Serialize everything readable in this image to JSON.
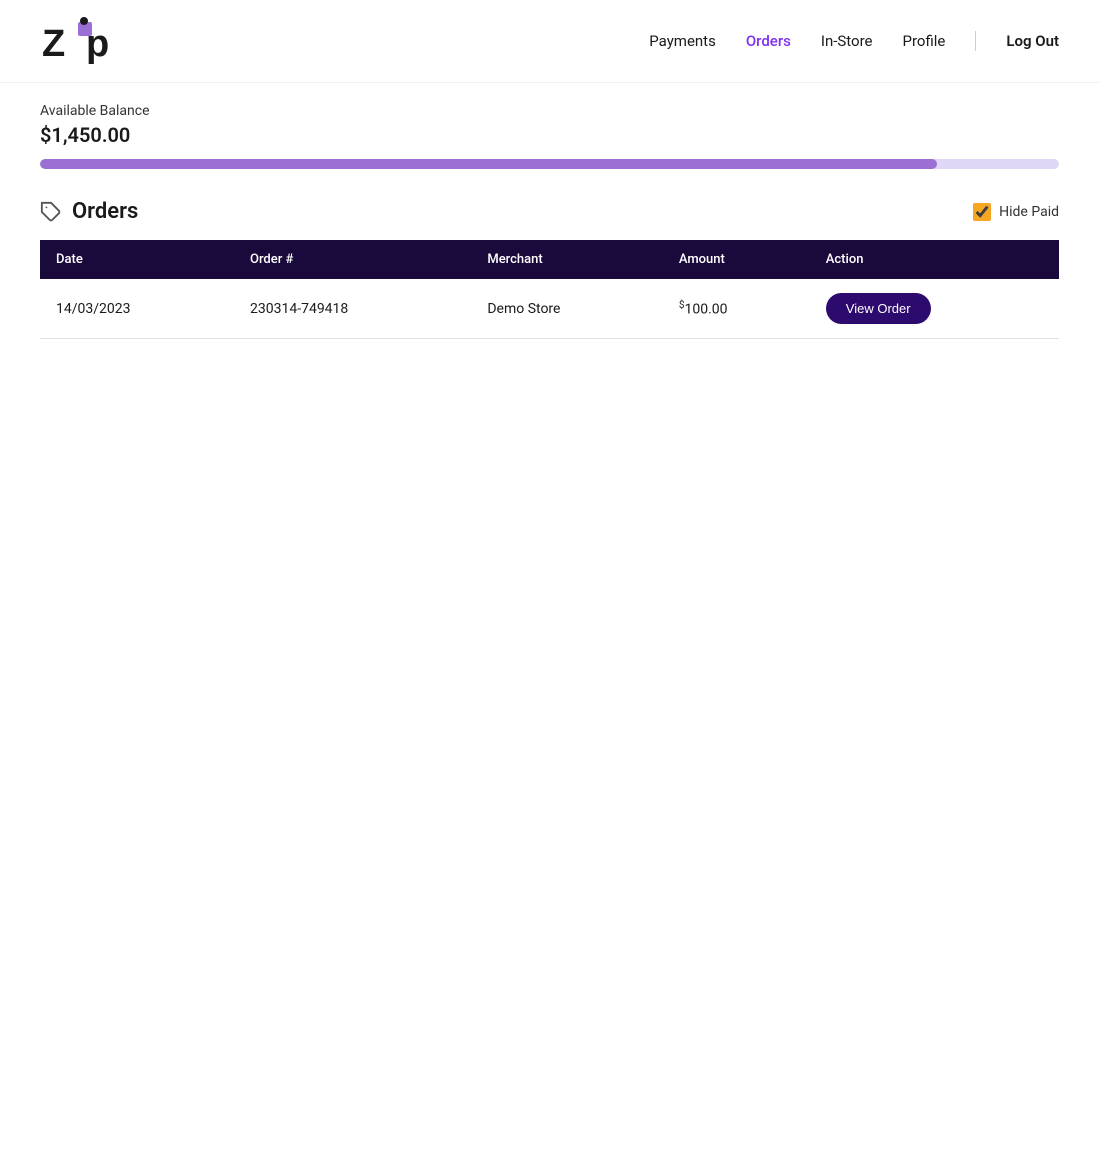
{
  "header": {
    "nav": {
      "payments_label": "Payments",
      "orders_label": "Orders",
      "instore_label": "In-Store",
      "profile_label": "Profile",
      "logout_label": "Log Out"
    }
  },
  "balance": {
    "label": "Available Balance",
    "amount": "$1,450.00",
    "fill_percent": 88
  },
  "orders": {
    "title": "Orders",
    "hide_paid_label": "Hide Paid",
    "table": {
      "columns": [
        "Date",
        "Order #",
        "Merchant",
        "Amount",
        "Action"
      ],
      "rows": [
        {
          "date": "14/03/2023",
          "order_number": "230314-749418",
          "merchant": "Demo Store",
          "amount_symbol": "$",
          "amount_main": "100",
          "amount_decimal": ".00",
          "action_label": "View Order"
        }
      ]
    }
  }
}
